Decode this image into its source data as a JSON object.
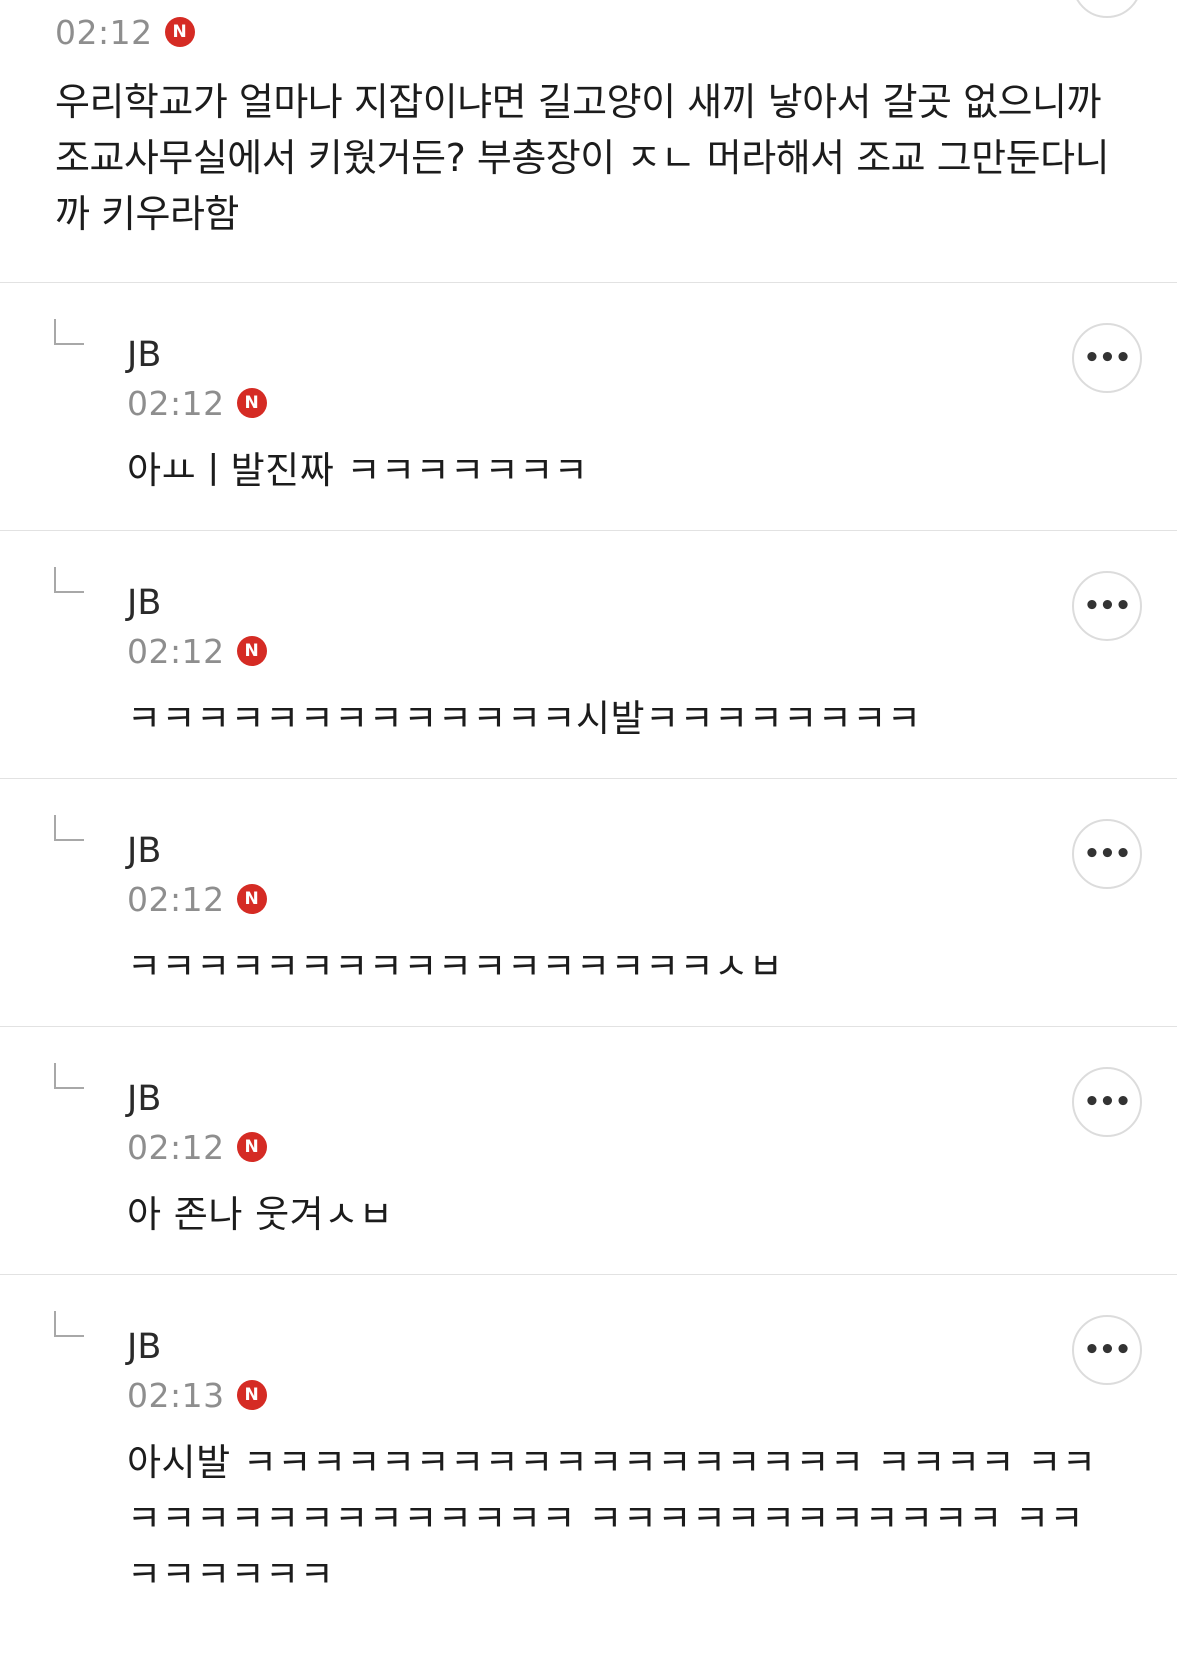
{
  "top_comment": {
    "time": "02:12",
    "badge": "N",
    "text": "우리학교가 얼마나 지잡이냐면 길고양이 새끼 낳아서 갈곳 없으니까 조교사무실에서 키웠거든? 부총장이 ㅈㄴ 머라해서 조교 그만둔다니까 키우라함"
  },
  "more_icon_glyph": "•••",
  "badge_color": "#d52b24",
  "replies": [
    {
      "author": "JB",
      "time": "02:12",
      "badge": "N",
      "text": "아ㅛㅣ발진짜 ㅋㅋㅋㅋㅋㅋㅋ"
    },
    {
      "author": "JB",
      "time": "02:12",
      "badge": "N",
      "text": "ㅋㅋㅋㅋㅋㅋㅋㅋㅋㅋㅋㅋㅋ시발ㅋㅋㅋㅋㅋㅋㅋㅋ"
    },
    {
      "author": "JB",
      "time": "02:12",
      "badge": "N",
      "text": "ㅋㅋㅋㅋㅋㅋㅋㅋㅋㅋㅋㅋㅋㅋㅋㅋㅋㅅㅂ"
    },
    {
      "author": "JB",
      "time": "02:12",
      "badge": "N",
      "text": "아 존나 웃겨ㅅㅂ"
    },
    {
      "author": "JB",
      "time": "02:13",
      "badge": "N",
      "text": "아시발 ㅋㅋㅋㅋㅋㅋㅋㅋㅋㅋㅋㅋㅋㅋㅋㅋㅋㅋ ㅋㅋㅋㅋ ㅋㅋㅋㅋㅋㅋㅋㅋㅋㅋㅋㅋㅋㅋㅋ ㅋㅋㅋㅋㅋㅋㅋㅋㅋㅋㅋㅋ ㅋㅋㅋㅋㅋㅋㅋㅋ"
    }
  ]
}
